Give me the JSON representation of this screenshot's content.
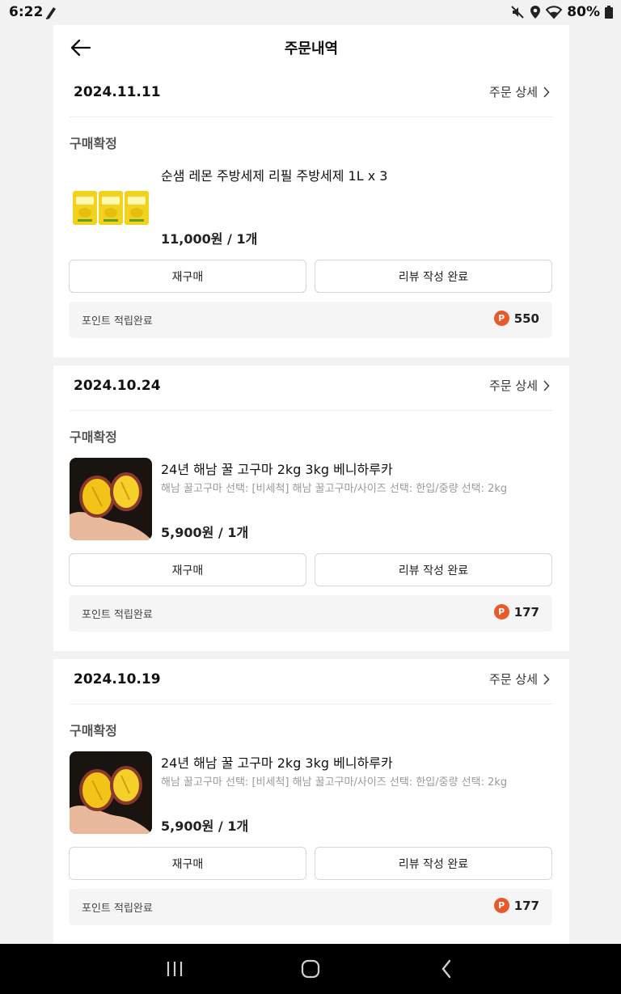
{
  "status_bar": {
    "time": "6:22",
    "battery": "80%"
  },
  "header": {
    "title": "주문내역"
  },
  "orders": [
    {
      "date": "2024.11.11",
      "detail_label": "주문 상세",
      "status": "구매확정",
      "product_name": "순샘 레몬 주방세제 리필 주방세제 1L x 3",
      "product_option": "",
      "price": "11,000원 / 1개",
      "rebuy_label": "재구매",
      "review_label": "리뷰 작성 완료",
      "points_label": "포인트 적립완료",
      "points_badge": "P",
      "points_value": "550"
    },
    {
      "date": "2024.10.24",
      "detail_label": "주문 상세",
      "status": "구매확정",
      "product_name": "24년 해남 꿀 고구마 2kg 3kg 베니하루카",
      "product_option": "해남 꿀고구마 선택: [비세척] 해남 꿀고구마/사이즈 선택: 한입/중량 선택: 2kg",
      "price": "5,900원 / 1개",
      "rebuy_label": "재구매",
      "review_label": "리뷰 작성 완료",
      "points_label": "포인트 적립완료",
      "points_badge": "P",
      "points_value": "177"
    },
    {
      "date": "2024.10.19",
      "detail_label": "주문 상세",
      "status": "구매확정",
      "product_name": "24년 해남 꿀 고구마 2kg 3kg 베니하루카",
      "product_option": "해남 꿀고구마 선택: [비세척] 해남 꿀고구마/사이즈 선택: 한입/중량 선택: 2kg",
      "price": "5,900원 / 1개",
      "rebuy_label": "재구매",
      "review_label": "리뷰 작성 완료",
      "points_label": "포인트 적립완료",
      "points_badge": "P",
      "points_value": "177"
    }
  ],
  "icons": {
    "back": "arrow-left-icon",
    "chevron": "chevron-right-icon",
    "nav_recent": "recent-apps-icon",
    "nav_home": "home-icon",
    "nav_back": "nav-back-icon"
  },
  "colors": {
    "points_badge": "#e85a2a",
    "background": "#f2f2f2"
  }
}
